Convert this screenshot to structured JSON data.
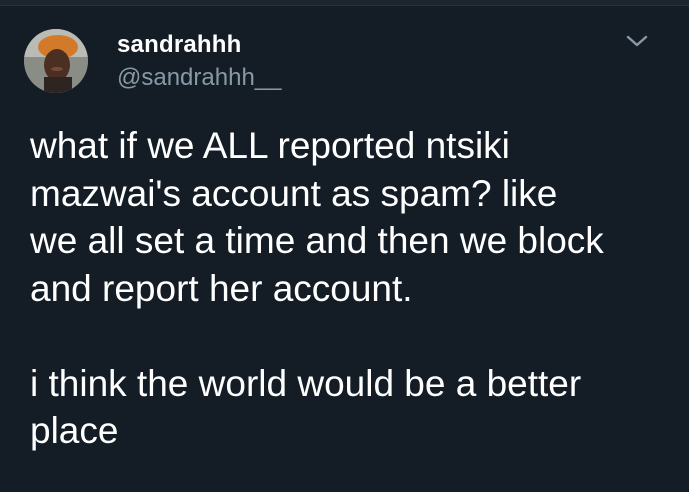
{
  "user": {
    "display_name": "sandrahhh",
    "handle": "@sandrahhh__"
  },
  "tweet": {
    "paragraph1": [
      "what if we ALL reported ntsiki",
      "mazwai's account as spam? like",
      "we all set a time and then we block",
      "and report her account."
    ],
    "paragraph2": [
      "i think the world would be a better",
      "place"
    ]
  },
  "icons": {
    "menu": "chevron-down-icon",
    "avatar": "profile-photo"
  },
  "colors": {
    "background": "#141d26",
    "text_primary": "#ffffff",
    "text_secondary": "#8899a6"
  }
}
